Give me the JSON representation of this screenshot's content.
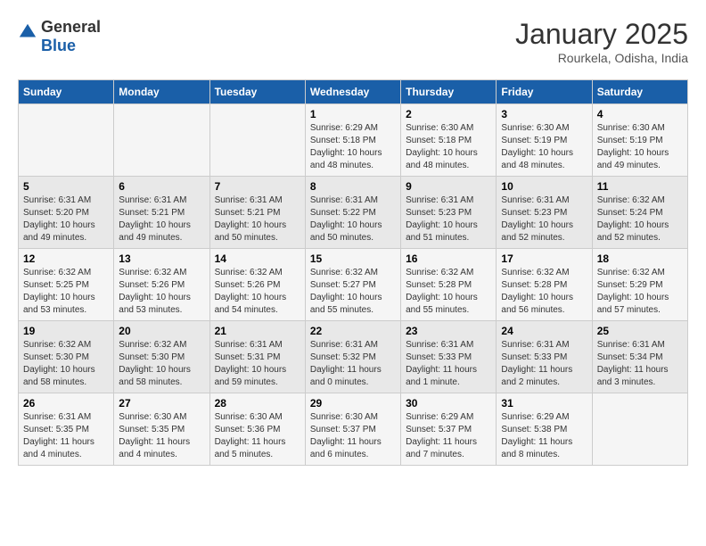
{
  "header": {
    "logo_general": "General",
    "logo_blue": "Blue",
    "title": "January 2025",
    "subtitle": "Rourkela, Odisha, India"
  },
  "weekdays": [
    "Sunday",
    "Monday",
    "Tuesday",
    "Wednesday",
    "Thursday",
    "Friday",
    "Saturday"
  ],
  "weeks": [
    [
      {
        "day": "",
        "info": ""
      },
      {
        "day": "",
        "info": ""
      },
      {
        "day": "",
        "info": ""
      },
      {
        "day": "1",
        "info": "Sunrise: 6:29 AM\nSunset: 5:18 PM\nDaylight: 10 hours\nand 48 minutes."
      },
      {
        "day": "2",
        "info": "Sunrise: 6:30 AM\nSunset: 5:18 PM\nDaylight: 10 hours\nand 48 minutes."
      },
      {
        "day": "3",
        "info": "Sunrise: 6:30 AM\nSunset: 5:19 PM\nDaylight: 10 hours\nand 48 minutes."
      },
      {
        "day": "4",
        "info": "Sunrise: 6:30 AM\nSunset: 5:19 PM\nDaylight: 10 hours\nand 49 minutes."
      }
    ],
    [
      {
        "day": "5",
        "info": "Sunrise: 6:31 AM\nSunset: 5:20 PM\nDaylight: 10 hours\nand 49 minutes."
      },
      {
        "day": "6",
        "info": "Sunrise: 6:31 AM\nSunset: 5:21 PM\nDaylight: 10 hours\nand 49 minutes."
      },
      {
        "day": "7",
        "info": "Sunrise: 6:31 AM\nSunset: 5:21 PM\nDaylight: 10 hours\nand 50 minutes."
      },
      {
        "day": "8",
        "info": "Sunrise: 6:31 AM\nSunset: 5:22 PM\nDaylight: 10 hours\nand 50 minutes."
      },
      {
        "day": "9",
        "info": "Sunrise: 6:31 AM\nSunset: 5:23 PM\nDaylight: 10 hours\nand 51 minutes."
      },
      {
        "day": "10",
        "info": "Sunrise: 6:31 AM\nSunset: 5:23 PM\nDaylight: 10 hours\nand 52 minutes."
      },
      {
        "day": "11",
        "info": "Sunrise: 6:32 AM\nSunset: 5:24 PM\nDaylight: 10 hours\nand 52 minutes."
      }
    ],
    [
      {
        "day": "12",
        "info": "Sunrise: 6:32 AM\nSunset: 5:25 PM\nDaylight: 10 hours\nand 53 minutes."
      },
      {
        "day": "13",
        "info": "Sunrise: 6:32 AM\nSunset: 5:26 PM\nDaylight: 10 hours\nand 53 minutes."
      },
      {
        "day": "14",
        "info": "Sunrise: 6:32 AM\nSunset: 5:26 PM\nDaylight: 10 hours\nand 54 minutes."
      },
      {
        "day": "15",
        "info": "Sunrise: 6:32 AM\nSunset: 5:27 PM\nDaylight: 10 hours\nand 55 minutes."
      },
      {
        "day": "16",
        "info": "Sunrise: 6:32 AM\nSunset: 5:28 PM\nDaylight: 10 hours\nand 55 minutes."
      },
      {
        "day": "17",
        "info": "Sunrise: 6:32 AM\nSunset: 5:28 PM\nDaylight: 10 hours\nand 56 minutes."
      },
      {
        "day": "18",
        "info": "Sunrise: 6:32 AM\nSunset: 5:29 PM\nDaylight: 10 hours\nand 57 minutes."
      }
    ],
    [
      {
        "day": "19",
        "info": "Sunrise: 6:32 AM\nSunset: 5:30 PM\nDaylight: 10 hours\nand 58 minutes."
      },
      {
        "day": "20",
        "info": "Sunrise: 6:32 AM\nSunset: 5:30 PM\nDaylight: 10 hours\nand 58 minutes."
      },
      {
        "day": "21",
        "info": "Sunrise: 6:31 AM\nSunset: 5:31 PM\nDaylight: 10 hours\nand 59 minutes."
      },
      {
        "day": "22",
        "info": "Sunrise: 6:31 AM\nSunset: 5:32 PM\nDaylight: 11 hours\nand 0 minutes."
      },
      {
        "day": "23",
        "info": "Sunrise: 6:31 AM\nSunset: 5:33 PM\nDaylight: 11 hours\nand 1 minute."
      },
      {
        "day": "24",
        "info": "Sunrise: 6:31 AM\nSunset: 5:33 PM\nDaylight: 11 hours\nand 2 minutes."
      },
      {
        "day": "25",
        "info": "Sunrise: 6:31 AM\nSunset: 5:34 PM\nDaylight: 11 hours\nand 3 minutes."
      }
    ],
    [
      {
        "day": "26",
        "info": "Sunrise: 6:31 AM\nSunset: 5:35 PM\nDaylight: 11 hours\nand 4 minutes."
      },
      {
        "day": "27",
        "info": "Sunrise: 6:30 AM\nSunset: 5:35 PM\nDaylight: 11 hours\nand 4 minutes."
      },
      {
        "day": "28",
        "info": "Sunrise: 6:30 AM\nSunset: 5:36 PM\nDaylight: 11 hours\nand 5 minutes."
      },
      {
        "day": "29",
        "info": "Sunrise: 6:30 AM\nSunset: 5:37 PM\nDaylight: 11 hours\nand 6 minutes."
      },
      {
        "day": "30",
        "info": "Sunrise: 6:29 AM\nSunset: 5:37 PM\nDaylight: 11 hours\nand 7 minutes."
      },
      {
        "day": "31",
        "info": "Sunrise: 6:29 AM\nSunset: 5:38 PM\nDaylight: 11 hours\nand 8 minutes."
      },
      {
        "day": "",
        "info": ""
      }
    ]
  ]
}
